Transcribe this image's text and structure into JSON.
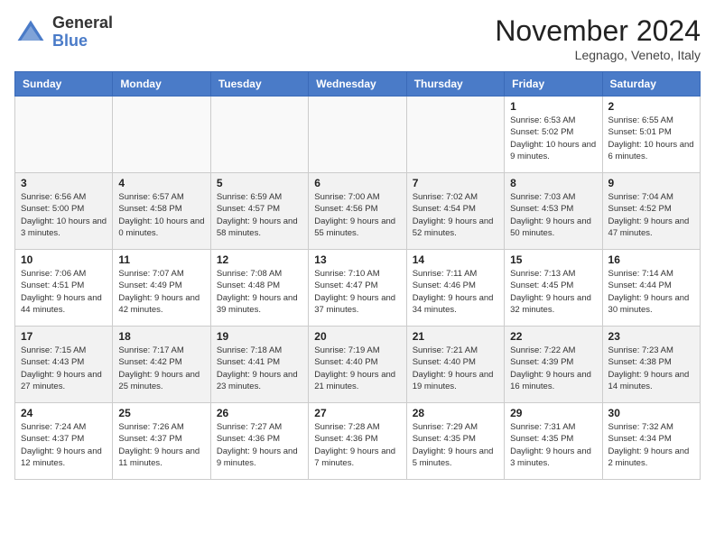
{
  "header": {
    "logo_general": "General",
    "logo_blue": "Blue",
    "month_title": "November 2024",
    "location": "Legnago, Veneto, Italy"
  },
  "days_of_week": [
    "Sunday",
    "Monday",
    "Tuesday",
    "Wednesday",
    "Thursday",
    "Friday",
    "Saturday"
  ],
  "weeks": [
    [
      {
        "day": "",
        "info": ""
      },
      {
        "day": "",
        "info": ""
      },
      {
        "day": "",
        "info": ""
      },
      {
        "day": "",
        "info": ""
      },
      {
        "day": "",
        "info": ""
      },
      {
        "day": "1",
        "info": "Sunrise: 6:53 AM\nSunset: 5:02 PM\nDaylight: 10 hours and 9 minutes."
      },
      {
        "day": "2",
        "info": "Sunrise: 6:55 AM\nSunset: 5:01 PM\nDaylight: 10 hours and 6 minutes."
      }
    ],
    [
      {
        "day": "3",
        "info": "Sunrise: 6:56 AM\nSunset: 5:00 PM\nDaylight: 10 hours and 3 minutes."
      },
      {
        "day": "4",
        "info": "Sunrise: 6:57 AM\nSunset: 4:58 PM\nDaylight: 10 hours and 0 minutes."
      },
      {
        "day": "5",
        "info": "Sunrise: 6:59 AM\nSunset: 4:57 PM\nDaylight: 9 hours and 58 minutes."
      },
      {
        "day": "6",
        "info": "Sunrise: 7:00 AM\nSunset: 4:56 PM\nDaylight: 9 hours and 55 minutes."
      },
      {
        "day": "7",
        "info": "Sunrise: 7:02 AM\nSunset: 4:54 PM\nDaylight: 9 hours and 52 minutes."
      },
      {
        "day": "8",
        "info": "Sunrise: 7:03 AM\nSunset: 4:53 PM\nDaylight: 9 hours and 50 minutes."
      },
      {
        "day": "9",
        "info": "Sunrise: 7:04 AM\nSunset: 4:52 PM\nDaylight: 9 hours and 47 minutes."
      }
    ],
    [
      {
        "day": "10",
        "info": "Sunrise: 7:06 AM\nSunset: 4:51 PM\nDaylight: 9 hours and 44 minutes."
      },
      {
        "day": "11",
        "info": "Sunrise: 7:07 AM\nSunset: 4:49 PM\nDaylight: 9 hours and 42 minutes."
      },
      {
        "day": "12",
        "info": "Sunrise: 7:08 AM\nSunset: 4:48 PM\nDaylight: 9 hours and 39 minutes."
      },
      {
        "day": "13",
        "info": "Sunrise: 7:10 AM\nSunset: 4:47 PM\nDaylight: 9 hours and 37 minutes."
      },
      {
        "day": "14",
        "info": "Sunrise: 7:11 AM\nSunset: 4:46 PM\nDaylight: 9 hours and 34 minutes."
      },
      {
        "day": "15",
        "info": "Sunrise: 7:13 AM\nSunset: 4:45 PM\nDaylight: 9 hours and 32 minutes."
      },
      {
        "day": "16",
        "info": "Sunrise: 7:14 AM\nSunset: 4:44 PM\nDaylight: 9 hours and 30 minutes."
      }
    ],
    [
      {
        "day": "17",
        "info": "Sunrise: 7:15 AM\nSunset: 4:43 PM\nDaylight: 9 hours and 27 minutes."
      },
      {
        "day": "18",
        "info": "Sunrise: 7:17 AM\nSunset: 4:42 PM\nDaylight: 9 hours and 25 minutes."
      },
      {
        "day": "19",
        "info": "Sunrise: 7:18 AM\nSunset: 4:41 PM\nDaylight: 9 hours and 23 minutes."
      },
      {
        "day": "20",
        "info": "Sunrise: 7:19 AM\nSunset: 4:40 PM\nDaylight: 9 hours and 21 minutes."
      },
      {
        "day": "21",
        "info": "Sunrise: 7:21 AM\nSunset: 4:40 PM\nDaylight: 9 hours and 19 minutes."
      },
      {
        "day": "22",
        "info": "Sunrise: 7:22 AM\nSunset: 4:39 PM\nDaylight: 9 hours and 16 minutes."
      },
      {
        "day": "23",
        "info": "Sunrise: 7:23 AM\nSunset: 4:38 PM\nDaylight: 9 hours and 14 minutes."
      }
    ],
    [
      {
        "day": "24",
        "info": "Sunrise: 7:24 AM\nSunset: 4:37 PM\nDaylight: 9 hours and 12 minutes."
      },
      {
        "day": "25",
        "info": "Sunrise: 7:26 AM\nSunset: 4:37 PM\nDaylight: 9 hours and 11 minutes."
      },
      {
        "day": "26",
        "info": "Sunrise: 7:27 AM\nSunset: 4:36 PM\nDaylight: 9 hours and 9 minutes."
      },
      {
        "day": "27",
        "info": "Sunrise: 7:28 AM\nSunset: 4:36 PM\nDaylight: 9 hours and 7 minutes."
      },
      {
        "day": "28",
        "info": "Sunrise: 7:29 AM\nSunset: 4:35 PM\nDaylight: 9 hours and 5 minutes."
      },
      {
        "day": "29",
        "info": "Sunrise: 7:31 AM\nSunset: 4:35 PM\nDaylight: 9 hours and 3 minutes."
      },
      {
        "day": "30",
        "info": "Sunrise: 7:32 AM\nSunset: 4:34 PM\nDaylight: 9 hours and 2 minutes."
      }
    ]
  ]
}
